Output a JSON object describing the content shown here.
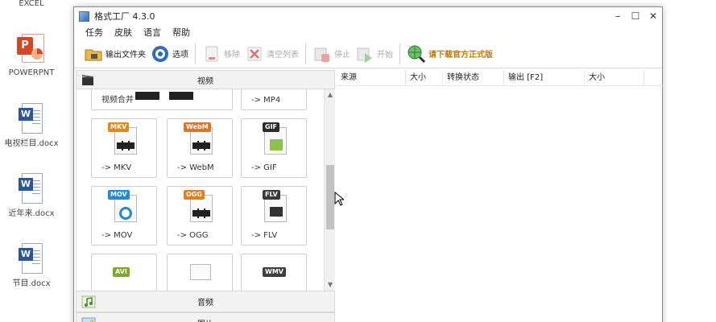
{
  "desktop": {
    "top_label": "EXCEL",
    "icons": [
      {
        "label": "POWERPNT",
        "type": "powerpoint"
      },
      {
        "label": "电视栏目.docx",
        "type": "word"
      },
      {
        "label": "近年来.docx",
        "type": "word"
      },
      {
        "label": "节目.docx",
        "type": "word"
      }
    ]
  },
  "window": {
    "title": "格式工厂 4.3.0",
    "controls": {
      "minimize": "–",
      "maximize": "☐",
      "close": "✕"
    }
  },
  "menu": [
    "任务",
    "皮肤",
    "语言",
    "帮助"
  ],
  "toolbar": {
    "output_folder": "输出文件夹",
    "options": "选项",
    "remove": "移除",
    "clear_list": "清空列表",
    "stop": "停止",
    "start": "开始",
    "download": "请下载官方正式版"
  },
  "left_panel": {
    "video_header": "视频",
    "tiles": [
      {
        "label": "视频合并",
        "badge": ""
      },
      {
        "label": "-> MP4",
        "badge": ""
      },
      {
        "label": "-> MKV",
        "badge": "MKV"
      },
      {
        "label": "-> WebM",
        "badge": "WebM"
      },
      {
        "label": "-> GIF",
        "badge": "GIF"
      },
      {
        "label": "-> MOV",
        "badge": "MOV"
      },
      {
        "label": "-> OGG",
        "badge": "OGG"
      },
      {
        "label": "-> FLV",
        "badge": "FLV"
      },
      {
        "label": "",
        "badge": "AVI"
      },
      {
        "label": "",
        "badge": ""
      },
      {
        "label": "",
        "badge": "WMV"
      }
    ],
    "categories": [
      "音频",
      "图片"
    ]
  },
  "table": {
    "columns": [
      "来源",
      "大小",
      "转换状态",
      "输出 [F2]",
      "大小"
    ]
  },
  "colors": {
    "accent": "#2b579a",
    "promo": "#c37a0a",
    "mkv": "#e08a1e",
    "webm": "#d9762b",
    "gif": "#2b2b2b",
    "mov": "#1f8bd6",
    "ogg": "#e07f22",
    "flv": "#3a3a3a",
    "avi": "#7aa82b",
    "wmv": "#3e3e3e"
  }
}
